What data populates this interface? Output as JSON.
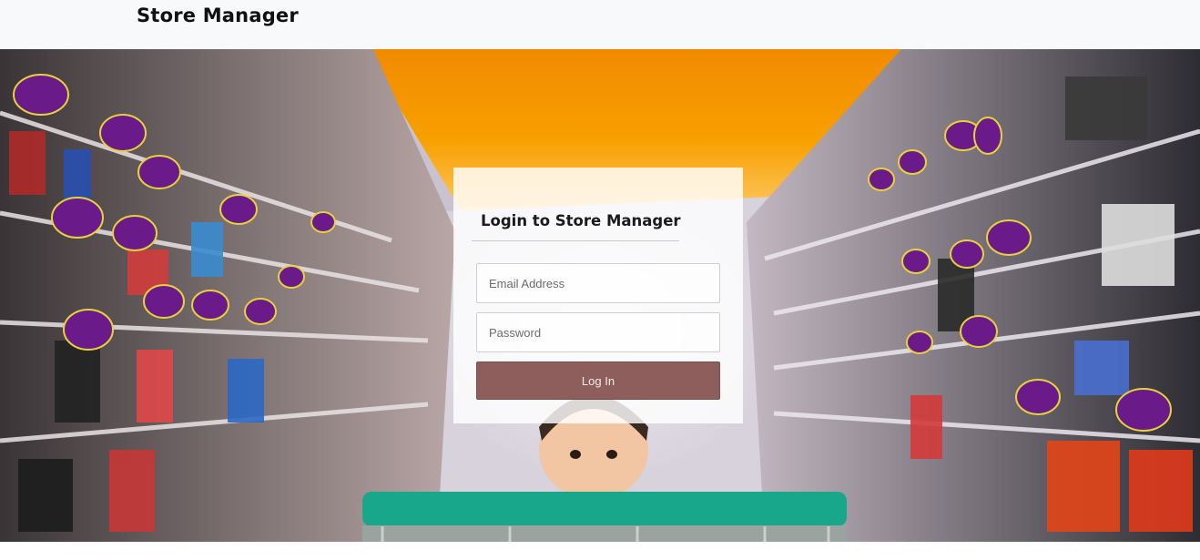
{
  "navbar": {
    "brand": "Store Manager"
  },
  "login": {
    "title": "Login to Store Manager",
    "email_placeholder": "Email Address",
    "password_placeholder": "Password",
    "submit_label": "Log In"
  },
  "colors": {
    "accent_button": "#8d5e5c",
    "navbar_bg": "#f8f9fb"
  }
}
